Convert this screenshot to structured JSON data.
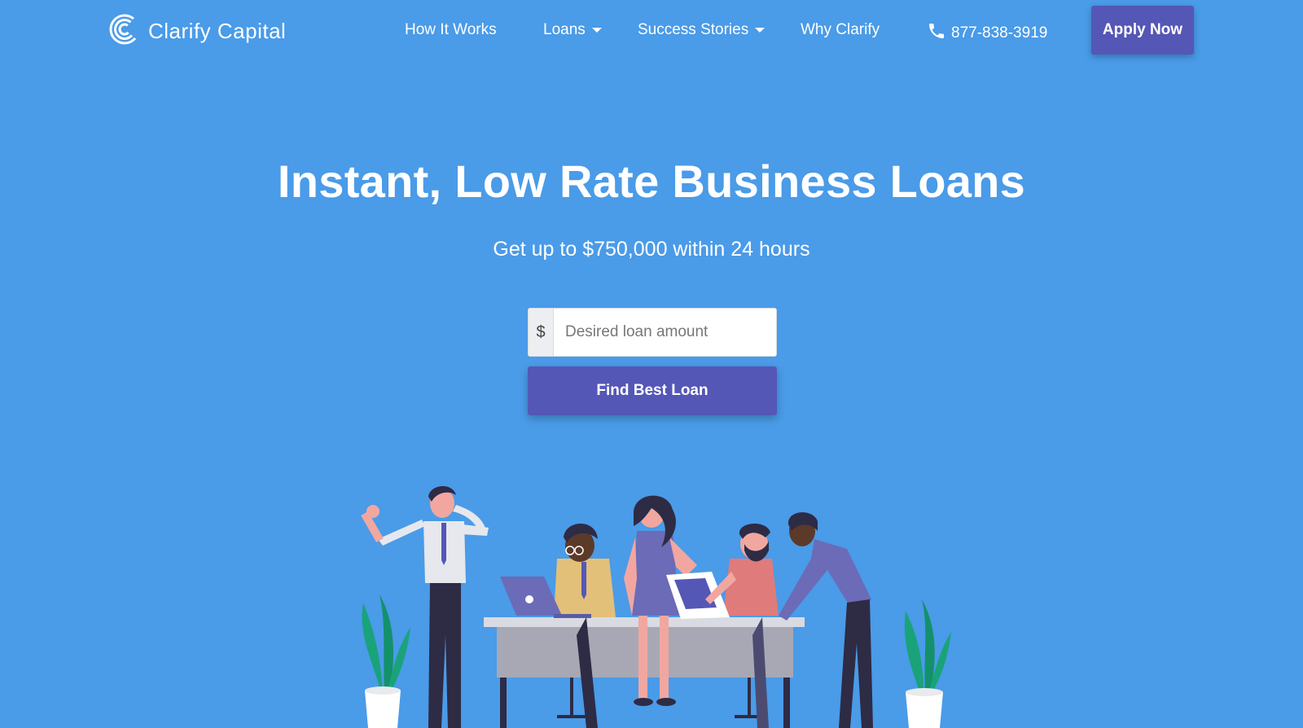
{
  "brand": {
    "name": "Clarify Capital"
  },
  "nav": {
    "items": [
      {
        "label": "How It Works",
        "dropdown": false
      },
      {
        "label": "Loans",
        "dropdown": true
      },
      {
        "label": "Success Stories",
        "dropdown": true
      },
      {
        "label": "Why Clarify",
        "dropdown": false
      }
    ],
    "phone": "877-838-3919",
    "apply_label": "Apply Now"
  },
  "hero": {
    "title": "Instant, Low Rate Business Loans",
    "subtitle": "Get up to $750,000 within 24 hours",
    "currency_prefix": "$",
    "amount_placeholder": "Desired loan amount",
    "amount_value": "",
    "cta_label": "Find Best Loan"
  },
  "colors": {
    "background": "#4a9be8",
    "button": "#5457b6",
    "plant": "#1aa37a"
  },
  "icons": [
    "clarify-logo-icon",
    "phone-icon",
    "caret-down-icon"
  ]
}
